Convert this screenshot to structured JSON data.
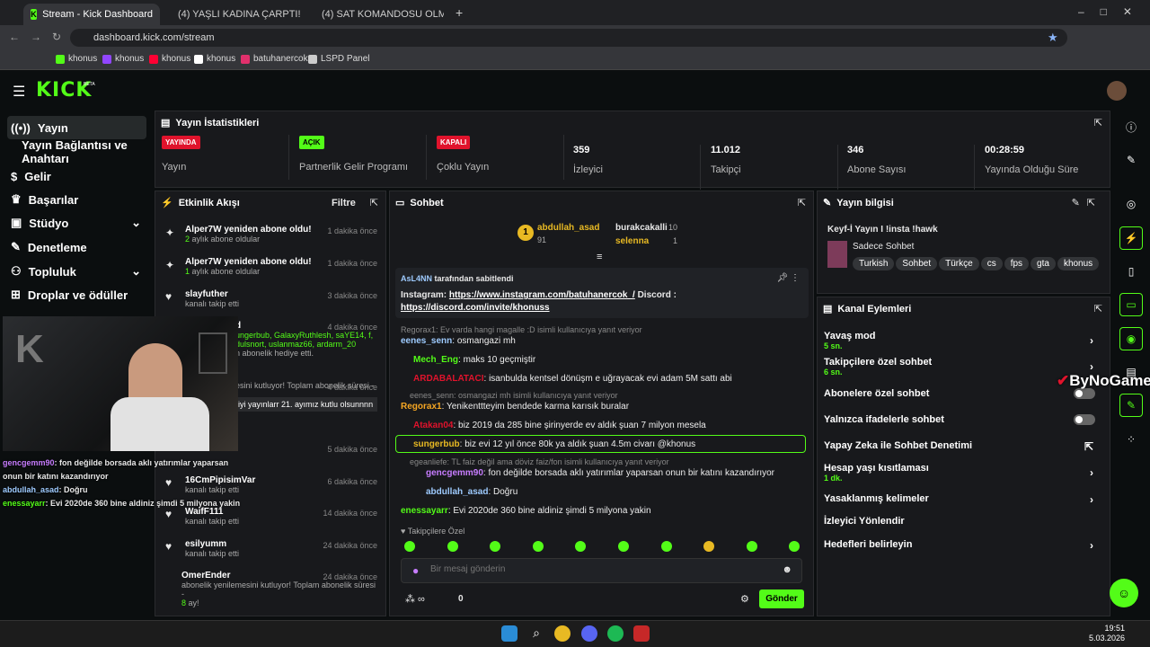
{
  "browser": {
    "tabs": [
      {
        "label": "Stream - Kick Dashboard"
      },
      {
        "label": "(4) YAŞLI KADINA ÇARPTI! Türki"
      },
      {
        "label": "(4) SAT KOMANDOSU OLMAYI"
      }
    ],
    "url": "dashboard.kick.com/stream",
    "bookmarks": [
      "khonus",
      "khonus",
      "khonus",
      "khonus",
      "batuhanercok",
      "LSPD Panel"
    ]
  },
  "brand": {
    "logo": "KICK",
    "beta": "BETA",
    "accent": "#53fc18"
  },
  "sidebar": {
    "items": [
      {
        "label": "Yayın"
      },
      {
        "label": "Yayın Bağlantısı ve Anahtarı"
      },
      {
        "label": "Gelir"
      },
      {
        "label": "Başarılar"
      },
      {
        "label": "Stüdyo"
      },
      {
        "label": "Denetleme"
      },
      {
        "label": "Topluluk"
      },
      {
        "label": "Droplar ve ödüller"
      }
    ]
  },
  "stats": {
    "title": "Yayın İstatistikleri",
    "items": [
      {
        "badge": "YAYINDA",
        "label": "Yayın",
        "color": "#e0132c"
      },
      {
        "badge": "AÇIK",
        "label": "Partnerlik Gelir Programı",
        "color": "#53fc18"
      },
      {
        "badge": "KAPALI",
        "label": "Çoklu Yayın",
        "color": "#e0132c"
      },
      {
        "value": "359",
        "label": "İzleyici"
      },
      {
        "value": "11.012",
        "label": "Takipçi"
      },
      {
        "value": "346",
        "label": "Abone Sayısı"
      },
      {
        "value": "00:28:59",
        "label": "Yayında Olduğu Süre"
      }
    ]
  },
  "activity": {
    "title": "Etkinlik Akışı",
    "filter": "Filtre",
    "events": [
      {
        "title": "Alper7W yeniden abone oldu!",
        "sub_num": "2",
        "sub": "aylık abone oldular",
        "time": "1 dakika önce"
      },
      {
        "title": "Alper7W yeniden abone oldu!",
        "sub_num": "1",
        "sub": "aylık abone oldular",
        "time": "1 dakika önce"
      },
      {
        "title": "slayfuther",
        "sub": "kanalı takip etti",
        "time": "3 dakika önce"
      },
      {
        "title": "d",
        "sub": "ungerbub, GalaxyRuthlesh, saYE14, f, dulsnort, uslanmaz66, ardarm_20",
        "sub2": "n abonelik hediye etti.",
        "time": "4 dakika önce"
      },
      {
        "title": "",
        "sub": "esini kutluyor! Toplam abonelik süresi -",
        "sub2": "iyi yayınlarr 21. ayımız kutlu olsunnnn",
        "time": "4 dakika önce"
      },
      {
        "title": "",
        "sub": "",
        "time": "5 dakika önce"
      },
      {
        "title": "16CmPipisimVar",
        "sub": "kanalı takip etti",
        "time": "6 dakika önce"
      },
      {
        "title": "WaifF111",
        "sub": "kanalı takip etti",
        "time": "14 dakika önce"
      },
      {
        "title": "esilyumm",
        "sub": "kanalı takip etti",
        "time": "24 dakika önce"
      },
      {
        "title": "OmerEnder",
        "sub": "abonelik yenilemesini kutluyor! Toplam abonelik süresi -",
        "sub_num": "8",
        "sub2": "ay!",
        "time": "24 dakika önce"
      }
    ]
  },
  "overlay": {
    "lines": [
      {
        "user": "gencgemm90",
        "text": ": fon değilde borsada aklı yatırımlar yaparsan"
      },
      {
        "user": "",
        "text": "onun bir katını kazandırıyor"
      },
      {
        "user": "abdullah_asad",
        "text": ": Doğru"
      },
      {
        "user": "enessayarr",
        "text": ": Evi 2020de 360 bine aldiniz şimdi 5 milyona yakin"
      }
    ]
  },
  "chat": {
    "title": "Sohbet",
    "top": [
      {
        "rank": "1",
        "name": "abdullah_asad",
        "count": "91",
        "color": "#e8b923"
      },
      {
        "name": "burakcakalli",
        "count": "10"
      },
      {
        "name": "selenna",
        "count": "1",
        "color": "#e8b923"
      }
    ],
    "pinned": {
      "by": "AsL4NN",
      "by_suffix": "tarafından sabitlendi",
      "text": "Instagram: ",
      "link1": "https://www.instagram.com/batuhanercok_/",
      "mid": " Discord :",
      "link2": "https://discord.com/invite/khonuss"
    },
    "messages": [
      {
        "reply": "Regorax1: Ev varda hangi magalle :D isimli kullanıcıya yanıt veriyor"
      },
      {
        "user": "eenes_senn",
        "text": ": osmangazi mh",
        "color": "#9ecbff"
      },
      {
        "user": "Mech_Eng",
        "text": ": maks 10 geçmiştir",
        "color": "#53fc18"
      },
      {
        "user": "ARDABALATACI",
        "text": ": isanbulda kentsel dönüşm e uğrayacak evi adam 5M sattı abi",
        "color": "#e0132c"
      },
      {
        "reply": "eenes_senn: osmangazi mh isimli kullanıcıya yanıt veriyor"
      },
      {
        "user": "Regorax1",
        "text": ": Yenikenttteyim bendede karma karısık buralar",
        "color": "#f5a623"
      },
      {
        "user": "Atakan04",
        "text": ": biz 2019 da 285 bine şirinyerde ev aldık şuan 7 milyon mesela",
        "color": "#e0132c"
      },
      {
        "user": "sungerbub",
        "text": ": biz evi 12 yıl önce 80k ya aldık şuan 4.5m civarı @khonus",
        "color": "#e8b923"
      },
      {
        "reply": "egeanliefe: TL faiz değil ama döviz faiz/fon isimli kullanıcıya yanıt veriyor"
      },
      {
        "user": "gencgemm90",
        "text": ": fon değilde borsada aklı yatırımlar yaparsan onun bir katını kazandırıyor",
        "color": "#c77dff"
      },
      {
        "user": "abdullah_asad",
        "text": ": Doğru",
        "color": "#9ecbff"
      },
      {
        "user": "enessayarr",
        "text": ": Evi 2020de 360 bine aldiniz şimdi 5 milyona yakin",
        "color": "#53fc18"
      }
    ],
    "emote_label": "Takipçilere Özel",
    "placeholder": "Bir mesaj gönderin",
    "points": "0",
    "send": "Gönder"
  },
  "info": {
    "title": "Yayın bilgisi",
    "stream_title": "Keyf-İ Yayın I !insta !hawk",
    "category": "Sadece Sohbet",
    "tags": [
      "Turkish",
      "Sohbet",
      "Türkçe",
      "cs",
      "fps",
      "gta",
      "khonus"
    ]
  },
  "actions": {
    "title": "Kanal Eylemleri",
    "items": [
      {
        "label": "Yavaş mod",
        "sub": "5 sn.",
        "type": "chevron"
      },
      {
        "label": "Takipçilere özel sohbet",
        "sub": "6 sn.",
        "type": "chevron"
      },
      {
        "label": "Abonelere özel sohbet",
        "type": "toggle"
      },
      {
        "label": "Yalnızca ifadelerle sohbet",
        "type": "toggle"
      },
      {
        "label": "Yapay Zeka ile Sohbet Denetimi",
        "type": "external"
      },
      {
        "label": "Hesap yaşı kısıtlaması",
        "sub": "1 dk.",
        "type": "chevron"
      },
      {
        "label": "Yasaklanmış kelimeler",
        "type": "chevron"
      },
      {
        "label": "İzleyici Yönlendir",
        "type": "none"
      },
      {
        "label": "Hedefleri belirleyin",
        "type": "chevron"
      }
    ]
  },
  "watermark": "ByNoGame",
  "taskbar": {
    "time": "19:51",
    "date": "5.03.2026"
  }
}
